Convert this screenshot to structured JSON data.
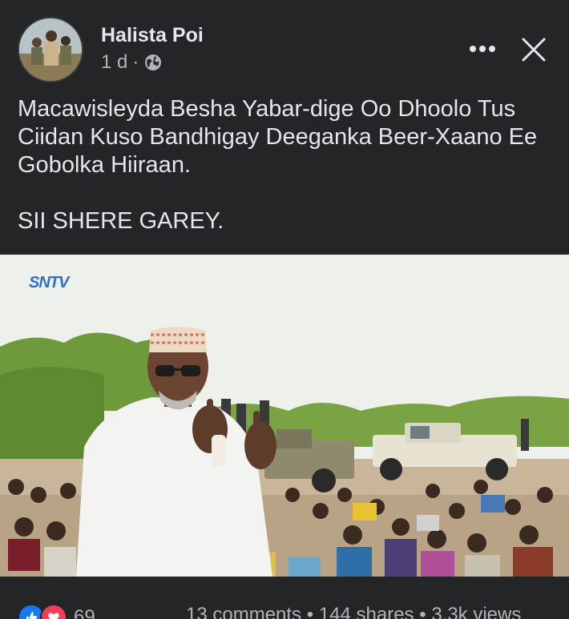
{
  "post": {
    "author": "Halista Poi",
    "time": "1 d",
    "separator": "·",
    "audience_icon": "globe-icon",
    "text_lines": [
      "Macawisleyda Besha Yabar-dige Oo Dhoolo Tus",
      "Ciidan Kuso Bandhigay Deeganka Beer-Xaano Ee",
      "Gobolka Hiiraan."
    ],
    "text_footer": "SII SHERE GAREY."
  },
  "media": {
    "watermark": "SNTV"
  },
  "footer": {
    "reaction_count": "69",
    "comments": "13 comments",
    "shares": "144 shares",
    "views": "3.3k views",
    "dot": "•"
  },
  "colors": {
    "background": "#242526",
    "text": "#e4e6eb",
    "muted": "#b0b3b8",
    "like": "#1877f2",
    "love": "#f33e58"
  }
}
